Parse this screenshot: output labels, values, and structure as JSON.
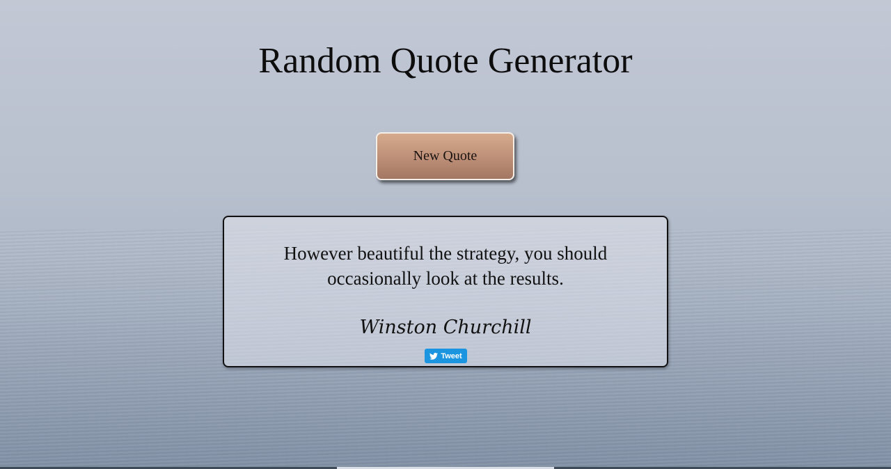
{
  "header": {
    "title": "Random Quote Generator"
  },
  "controls": {
    "new_quote_label": "New Quote"
  },
  "quote": {
    "text": "However beautiful the strategy, you should occasionally look at the results.",
    "author": "Winston Churchill"
  },
  "share": {
    "tweet_label": "Tweet",
    "icon": "twitter-bird-icon",
    "color": "#1b95e0"
  },
  "colors": {
    "button_top": "#d5ab8c",
    "button_bottom": "#a47763",
    "background": "#bcc3d1"
  }
}
